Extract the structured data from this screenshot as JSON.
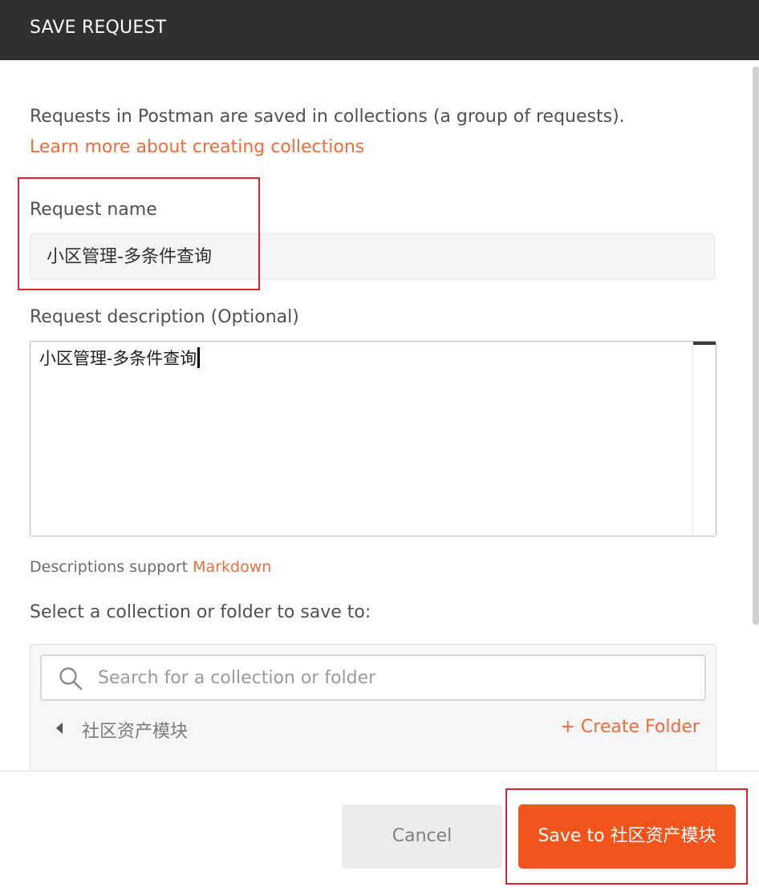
{
  "dialog": {
    "title": "SAVE REQUEST"
  },
  "intro": {
    "text": "Requests in Postman are saved in collections (a group of requests).",
    "link": "Learn more about creating collections"
  },
  "request_name": {
    "label": "Request name",
    "value": "小区管理-多条件查询"
  },
  "request_description": {
    "label": "Request description (Optional)",
    "value": "小区管理-多条件查询"
  },
  "markdown_note": {
    "prefix": "Descriptions support",
    "link": "Markdown"
  },
  "collection_select": {
    "label": "Select a collection or folder to save to:",
    "search_placeholder": "Search for a collection or folder",
    "current_folder": "社区资产模块",
    "create_folder": "+ Create Folder"
  },
  "footer": {
    "cancel_label": "Cancel",
    "save_label": "Save to 社区资产模块"
  },
  "colors": {
    "header_bg": "#303030",
    "accent": "#f26b3a",
    "primary_button": "#f2541b",
    "highlight_box": "#d9262e"
  },
  "icons": [
    "search-icon",
    "caret-left-icon"
  ]
}
